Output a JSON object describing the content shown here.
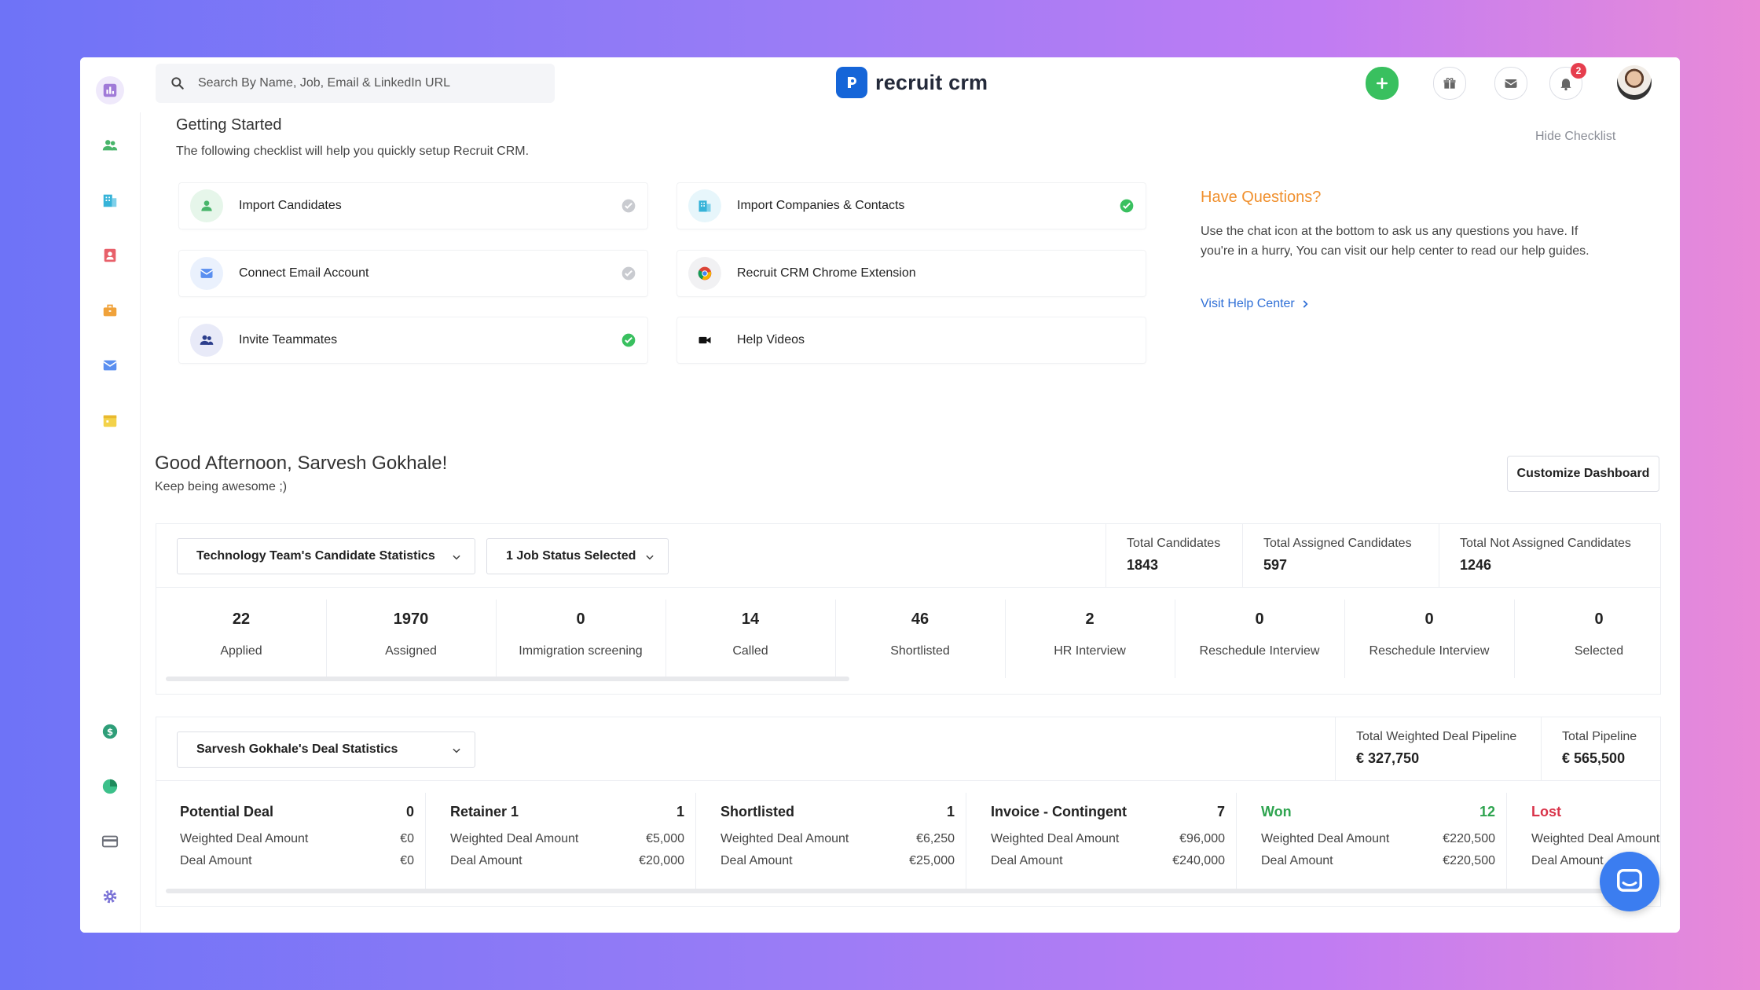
{
  "search": {
    "placeholder": "Search By Name, Job, Email & LinkedIn URL"
  },
  "brand": {
    "name": "recruit crm",
    "accent": "#1565d8"
  },
  "topbar": {
    "notification_count": "2",
    "icons": [
      "plus-icon",
      "gift-icon",
      "mail-icon",
      "bell-icon"
    ]
  },
  "sidebar": {
    "items": [
      "dashboard-icon",
      "candidates-icon",
      "companies-icon",
      "contacts-icon",
      "jobs-icon",
      "email-icon",
      "calendar-icon",
      "billing-icon",
      "reports-icon",
      "card-icon",
      "settings-icon"
    ]
  },
  "getting_started": {
    "title": "Getting Started",
    "subtitle": "The following checklist will help you quickly setup Recruit CRM.",
    "hide_label": "Hide Checklist",
    "items": [
      {
        "label": "Import Candidates",
        "done": false
      },
      {
        "label": "Import Companies & Contacts",
        "done": true
      },
      {
        "label": "Connect Email Account",
        "done": false
      },
      {
        "label": "Recruit CRM Chrome Extension",
        "done": false
      },
      {
        "label": "Invite Teammates",
        "done": true
      },
      {
        "label": "Help Videos",
        "done": false
      }
    ],
    "questions": {
      "title": "Have Questions?",
      "text": "Use the chat icon at the bottom to ask us any questions you have. If you're in a hurry, You can visit our help center to read our help guides.",
      "link": "Visit Help Center"
    }
  },
  "greeting": {
    "title": "Good Afternoon, Sarvesh Gokhale!",
    "subtitle": "Keep being awesome ;)",
    "customize": "Customize Dashboard"
  },
  "candidate_stats": {
    "team_select": "Technology Team's Candidate Statistics",
    "status_select": "1 Job Status Selected",
    "totals": [
      {
        "label": "Total Candidates",
        "value": "1843"
      },
      {
        "label": "Total Assigned Candidates",
        "value": "597"
      },
      {
        "label": "Total Not Assigned Candidates",
        "value": "1246"
      }
    ],
    "stages": [
      {
        "value": "22",
        "label": "Applied"
      },
      {
        "value": "1970",
        "label": "Assigned"
      },
      {
        "value": "0",
        "label": "Immigration screening"
      },
      {
        "value": "14",
        "label": "Called"
      },
      {
        "value": "46",
        "label": "Shortlisted"
      },
      {
        "value": "2",
        "label": "HR Interview"
      },
      {
        "value": "0",
        "label": "Reschedule Interview"
      },
      {
        "value": "0",
        "label": "Reschedule Interview"
      },
      {
        "value": "0",
        "label": "Selected"
      }
    ]
  },
  "deal_stats": {
    "select": "Sarvesh Gokhale's Deal Statistics",
    "totals": [
      {
        "label": "Total Weighted Deal Pipeline",
        "value": "€ 327,750"
      },
      {
        "label": "Total Pipeline",
        "value": "€ 565,500"
      }
    ],
    "row1_label": "Weighted Deal Amount",
    "row2_label": "Deal Amount",
    "stages": [
      {
        "name": "Potential Deal",
        "count": "0",
        "weighted": "€0",
        "amount": "€0",
        "color": "#222222"
      },
      {
        "name": "Retainer 1",
        "count": "1",
        "weighted": "€5,000",
        "amount": "€20,000",
        "color": "#222222"
      },
      {
        "name": "Shortlisted",
        "count": "1",
        "weighted": "€6,250",
        "amount": "€25,000",
        "color": "#222222"
      },
      {
        "name": "Invoice - Contingent",
        "count": "7",
        "weighted": "€96,000",
        "amount": "€240,000",
        "color": "#222222"
      },
      {
        "name": "Won",
        "count": "12",
        "weighted": "€220,500",
        "amount": "€220,500",
        "color": "#2ea44f"
      },
      {
        "name": "Lost",
        "count": "",
        "weighted": "",
        "amount": "",
        "color": "#d9344a"
      }
    ]
  }
}
